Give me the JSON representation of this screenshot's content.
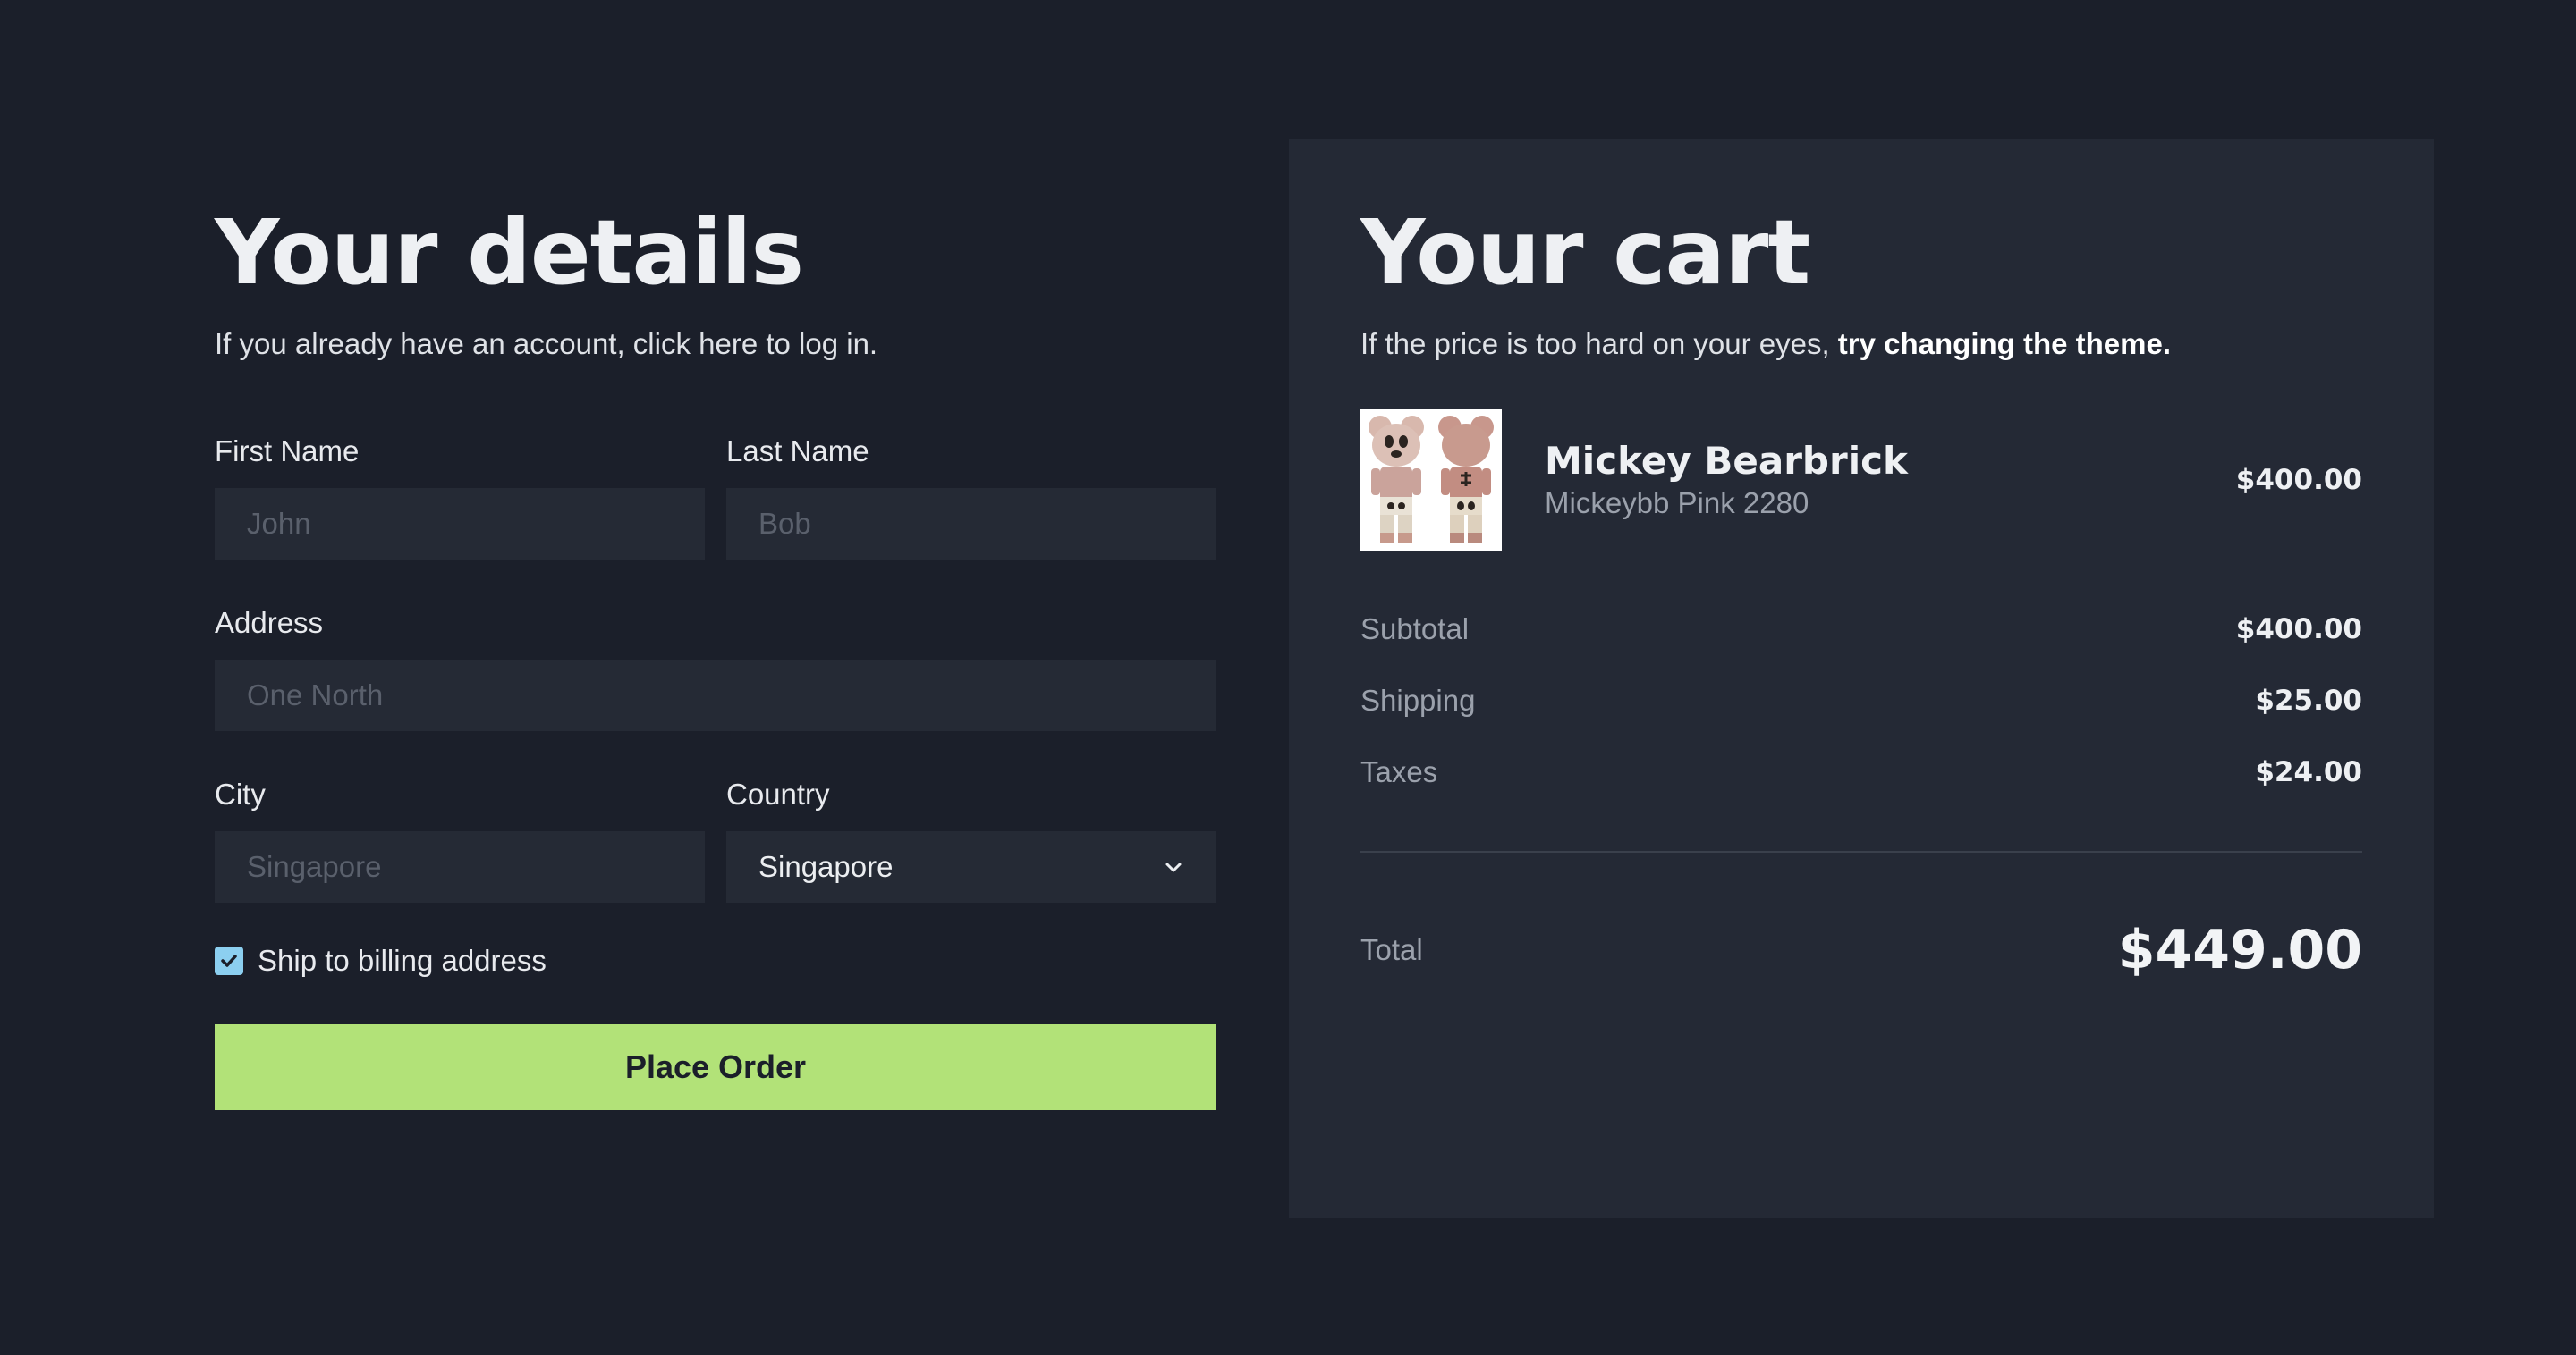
{
  "details": {
    "title": "Your details",
    "subtitle": "If you already have an account, click here to log in.",
    "first_name": {
      "label": "First Name",
      "placeholder": "John",
      "value": ""
    },
    "last_name": {
      "label": "Last Name",
      "placeholder": "Bob",
      "value": ""
    },
    "address": {
      "label": "Address",
      "placeholder": "One North",
      "value": ""
    },
    "city": {
      "label": "City",
      "placeholder": "Singapore",
      "value": ""
    },
    "country": {
      "label": "Country",
      "selected": "Singapore"
    },
    "ship_to_billing": {
      "label": "Ship to billing address",
      "checked": true
    },
    "place_order_label": "Place Order"
  },
  "cart": {
    "title": "Your cart",
    "subtitle_prefix": "If the price is too hard on your eyes, ",
    "subtitle_link": "try changing the theme.",
    "item": {
      "name": "Mickey Bearbrick",
      "description": "Mickeybb Pink 2280",
      "price": "$400.00",
      "image_icon": "bearbrick-figures-image"
    },
    "subtotal": {
      "label": "Subtotal",
      "value": "$400.00"
    },
    "shipping": {
      "label": "Shipping",
      "value": "$25.00"
    },
    "taxes": {
      "label": "Taxes",
      "value": "$24.00"
    },
    "total": {
      "label": "Total",
      "value": "$449.00"
    }
  },
  "colors": {
    "background": "#1b1f2a",
    "panel": "#242935",
    "input": "#252a35",
    "accent_button": "#b2e278",
    "checkbox": "#8ccff0"
  }
}
